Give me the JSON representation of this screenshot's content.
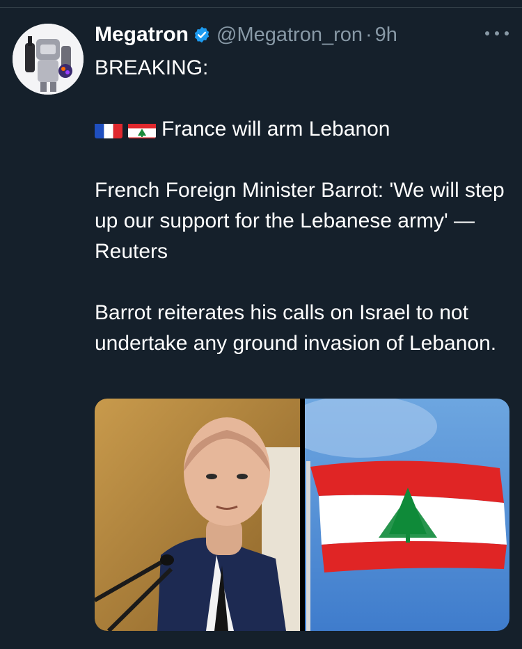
{
  "tweet": {
    "author_name": "Megatron",
    "handle": "@Megatron_ron",
    "separator": "·",
    "time": "9h",
    "lines": {
      "breaking": "BREAKING:",
      "headline": "France will arm Lebanon",
      "para2": "French Foreign Minister Barrot: 'We will step up our support for the Lebanese army' — Reuters",
      "para3": "Barrot reiterates his calls on Israel to not undertake any ground invasion of Lebanon."
    },
    "flags": [
      "france-flag-icon",
      "lebanon-flag-icon"
    ],
    "media": [
      "photo-minister",
      "photo-lebanon-flag"
    ]
  },
  "colors": {
    "background": "#15202b",
    "text_primary": "#ffffff",
    "text_secondary": "#8899a6",
    "verified": "#1d9bf0"
  }
}
